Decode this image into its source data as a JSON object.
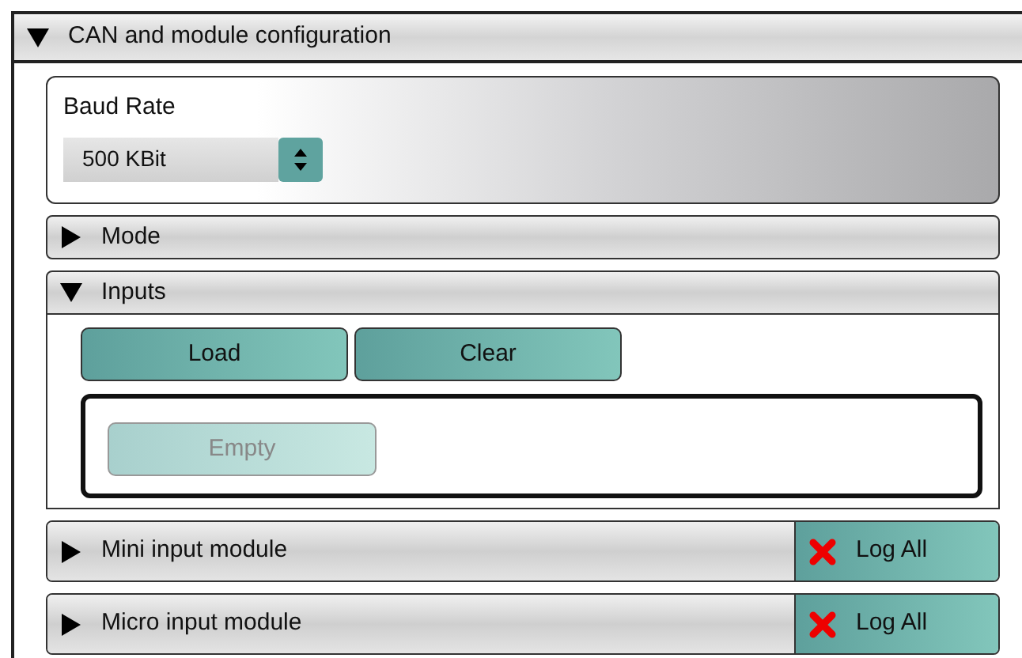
{
  "panel": {
    "title": "CAN and module configuration",
    "expanded": true
  },
  "baud_rate": {
    "label": "Baud Rate",
    "value": "500 KBit"
  },
  "sections": [
    {
      "title": "Mode",
      "expanded": false
    },
    {
      "title": "Inputs",
      "expanded": true,
      "buttons": [
        {
          "label": "Load",
          "disabled": false
        },
        {
          "label": "Clear",
          "disabled": false
        }
      ],
      "items": [
        {
          "label": "Empty",
          "disabled": true
        }
      ]
    }
  ],
  "modules": [
    {
      "title": "Mini input module",
      "expanded": false,
      "log_label": "Log All",
      "logging": false
    },
    {
      "title": "Micro input module",
      "expanded": false,
      "log_label": "Log All",
      "logging": false
    }
  ]
}
